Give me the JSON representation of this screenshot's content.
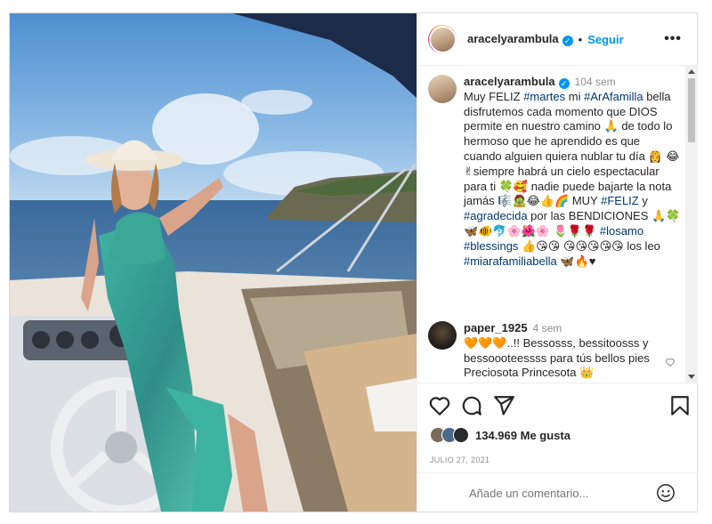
{
  "header": {
    "username": "aracelyarambula",
    "verified_mark": "✓",
    "separator": "•",
    "follow_label": "Seguir",
    "more_label": "•••"
  },
  "caption": {
    "username": "aracelyarambula",
    "time": "104 sem",
    "segments": [
      {
        "t": "Muy FELIZ ",
        "tag": false
      },
      {
        "t": "#martes",
        "tag": true
      },
      {
        "t": " mi ",
        "tag": false
      },
      {
        "t": "#ArAfamilla",
        "tag": true
      },
      {
        "t": " bella disfrutemos cada momento que DIOS permite en nuestro camino 🙏 de todo lo hermoso que he aprendido es que cuando alguien quiera nublar tu día 👸 😂✌siempre habrá un cielo espectacular para ti 🍀🥰 nadie puede bajarte la nota jamás 🎼🧟😂👍🌈 MUY ",
        "tag": false
      },
      {
        "t": "#FELIZ",
        "tag": true
      },
      {
        "t": " y ",
        "tag": false
      },
      {
        "t": "#agradecida",
        "tag": true
      },
      {
        "t": " por las BENDICIONES 🙏🍀🦋🐠🐬🌸🌺🌸 🌷🌹🌹 ",
        "tag": false
      },
      {
        "t": "#losamo",
        "tag": true
      },
      {
        "t": " ",
        "tag": false
      },
      {
        "t": "#blessings",
        "tag": true
      },
      {
        "t": " 👍😘😘 😘😘😘😘😘 los leo ",
        "tag": false
      },
      {
        "t": "#miarafamiliabella",
        "tag": true
      },
      {
        "t": " 🦋🔥♥",
        "tag": false
      }
    ]
  },
  "reply": {
    "username": "paper_1925",
    "time": "4 sem",
    "text": "🧡🧡🧡..!! Bessosss, bessitoosss y bessoooteessss para tús bellos pies Preciosota Princesota 👑"
  },
  "actions": {
    "like_icon": "heart-icon",
    "comment_icon": "comment-icon",
    "share_icon": "send-icon",
    "save_icon": "bookmark-icon",
    "likes_count": "134.969",
    "likes_label": "Me gusta",
    "date": "JULIO 27, 2021"
  },
  "add_comment": {
    "placeholder": "Añade un comentario...",
    "emoji_icon": "smiley-icon"
  },
  "colors": {
    "accent": "#0095f6",
    "hashtag": "#00376b",
    "muted": "#8e8e8e"
  }
}
